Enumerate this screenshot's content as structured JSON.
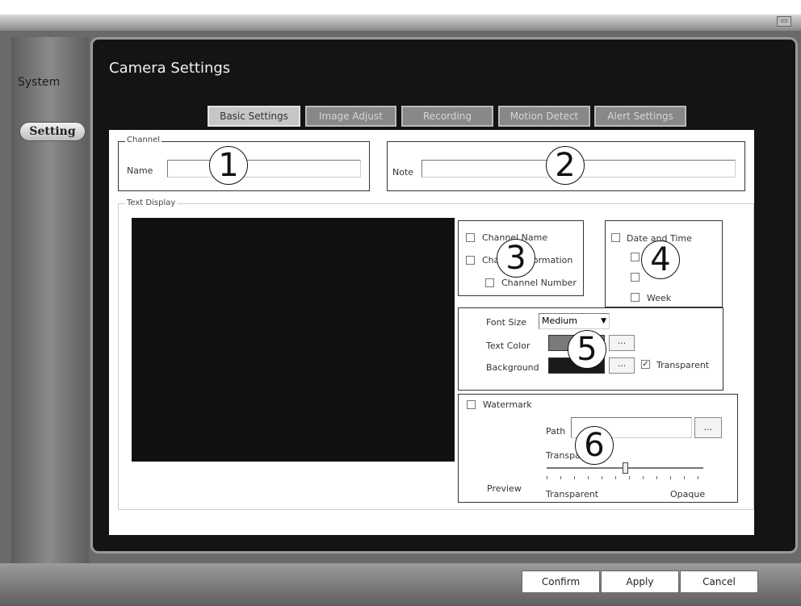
{
  "window": {
    "corner_icon": "window-icon"
  },
  "sidebar": {
    "items": [
      {
        "label": "System"
      },
      {
        "label": "Setting"
      }
    ]
  },
  "page": {
    "title": "Camera Settings"
  },
  "tabs": [
    {
      "label": "Basic Settings",
      "active": true
    },
    {
      "label": "Image Adjust",
      "active": false
    },
    {
      "label": "Recording",
      "active": false
    },
    {
      "label": "Motion Detect",
      "active": false
    },
    {
      "label": "Alert Settings",
      "active": false
    }
  ],
  "channel": {
    "group_label": "Channel",
    "name_label": "Name",
    "name_value": ""
  },
  "note": {
    "label": "Note",
    "value": ""
  },
  "text_display": {
    "group_label": "Text Display",
    "channel_name_label": "Channel Name",
    "channel_info_label": "Channel Information",
    "channel_number_label": "Channel Number",
    "date_time_label": "Date and Time",
    "week_label": "Week"
  },
  "font": {
    "size_label": "Font Size",
    "size_value": "Medium",
    "text_color_label": "Text Color",
    "background_label": "Background",
    "browse_label": "...",
    "transparent_label": "Transparent",
    "transparent_checked": true,
    "text_color": "#7a7a7a",
    "background_color": "#1a1a1a"
  },
  "watermark": {
    "label": "Watermark",
    "path_label": "Path",
    "path_value": "",
    "browse_label": "...",
    "transparency_label": "Transparency",
    "preview_label": "Preview",
    "min_label": "Transparent",
    "max_label": "Opaque",
    "transparency_level": 0.5
  },
  "callouts": [
    "1",
    "2",
    "3",
    "4",
    "5",
    "6"
  ],
  "footer": {
    "confirm_label": "Confirm",
    "apply_label": "Apply",
    "cancel_label": "Cancel"
  }
}
